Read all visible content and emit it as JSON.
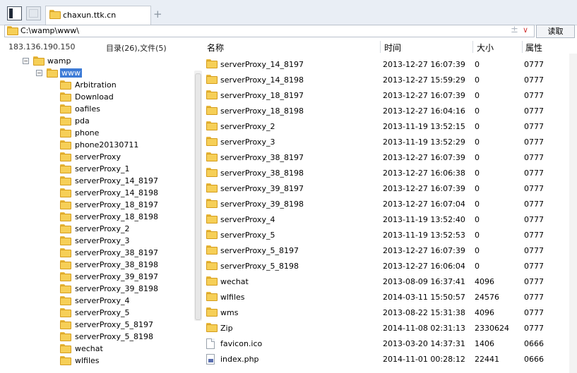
{
  "tab": {
    "title": "chaxun.ttk.cn",
    "add": "+"
  },
  "address": {
    "path": "C:\\wamp\\www\\",
    "plus": "±",
    "dropdown": "∨",
    "read_label": "读取"
  },
  "header": {
    "ip": "183.136.190.150",
    "summary": "目录(26),文件(5)",
    "col_name": "名称",
    "col_time": "时间",
    "col_size": "大小",
    "col_attr": "属性"
  },
  "tree": {
    "root": {
      "label": "wamp",
      "toggle": "−"
    },
    "current": {
      "label": "www",
      "toggle": "−"
    },
    "children": [
      "Arbitration",
      "Download",
      "oafiles",
      "pda",
      "phone",
      "phone20130711",
      "serverProxy",
      "serverProxy_1",
      "serverProxy_14_8197",
      "serverProxy_14_8198",
      "serverProxy_18_8197",
      "serverProxy_18_8198",
      "serverProxy_2",
      "serverProxy_3",
      "serverProxy_38_8197",
      "serverProxy_38_8198",
      "serverProxy_39_8197",
      "serverProxy_39_8198",
      "serverProxy_4",
      "serverProxy_5",
      "serverProxy_5_8197",
      "serverProxy_5_8198",
      "wechat",
      "wlfiles"
    ]
  },
  "files": [
    {
      "type": "folder",
      "name": "serverProxy_14_8197",
      "time": "2013-12-27 16:07:39",
      "size": "0",
      "attr": "0777"
    },
    {
      "type": "folder",
      "name": "serverProxy_14_8198",
      "time": "2013-12-27 15:59:29",
      "size": "0",
      "attr": "0777"
    },
    {
      "type": "folder",
      "name": "serverProxy_18_8197",
      "time": "2013-12-27 16:07:39",
      "size": "0",
      "attr": "0777"
    },
    {
      "type": "folder",
      "name": "serverProxy_18_8198",
      "time": "2013-12-27 16:04:16",
      "size": "0",
      "attr": "0777"
    },
    {
      "type": "folder",
      "name": "serverProxy_2",
      "time": "2013-11-19 13:52:15",
      "size": "0",
      "attr": "0777"
    },
    {
      "type": "folder",
      "name": "serverProxy_3",
      "time": "2013-11-19 13:52:29",
      "size": "0",
      "attr": "0777"
    },
    {
      "type": "folder",
      "name": "serverProxy_38_8197",
      "time": "2013-12-27 16:07:39",
      "size": "0",
      "attr": "0777"
    },
    {
      "type": "folder",
      "name": "serverProxy_38_8198",
      "time": "2013-12-27 16:06:38",
      "size": "0",
      "attr": "0777"
    },
    {
      "type": "folder",
      "name": "serverProxy_39_8197",
      "time": "2013-12-27 16:07:39",
      "size": "0",
      "attr": "0777"
    },
    {
      "type": "folder",
      "name": "serverProxy_39_8198",
      "time": "2013-12-27 16:07:04",
      "size": "0",
      "attr": "0777"
    },
    {
      "type": "folder",
      "name": "serverProxy_4",
      "time": "2013-11-19 13:52:40",
      "size": "0",
      "attr": "0777"
    },
    {
      "type": "folder",
      "name": "serverProxy_5",
      "time": "2013-11-19 13:52:53",
      "size": "0",
      "attr": "0777"
    },
    {
      "type": "folder",
      "name": "serverProxy_5_8197",
      "time": "2013-12-27 16:07:39",
      "size": "0",
      "attr": "0777"
    },
    {
      "type": "folder",
      "name": "serverProxy_5_8198",
      "time": "2013-12-27 16:06:04",
      "size": "0",
      "attr": "0777"
    },
    {
      "type": "folder",
      "name": "wechat",
      "time": "2013-08-09 16:37:41",
      "size": "4096",
      "attr": "0777"
    },
    {
      "type": "folder",
      "name": "wlfiles",
      "time": "2014-03-11 15:50:57",
      "size": "24576",
      "attr": "0777"
    },
    {
      "type": "folder",
      "name": "wms",
      "time": "2013-08-22 15:31:38",
      "size": "4096",
      "attr": "0777"
    },
    {
      "type": "folder",
      "name": "Zip",
      "time": "2014-11-08 02:31:13",
      "size": "2330624",
      "attr": "0777"
    },
    {
      "type": "file",
      "name": "favicon.ico",
      "time": "2013-03-20 14:37:31",
      "size": "1406",
      "attr": "0666"
    },
    {
      "type": "php",
      "name": "index.php",
      "time": "2014-11-01 00:28:12",
      "size": "22441",
      "attr": "0666"
    }
  ]
}
